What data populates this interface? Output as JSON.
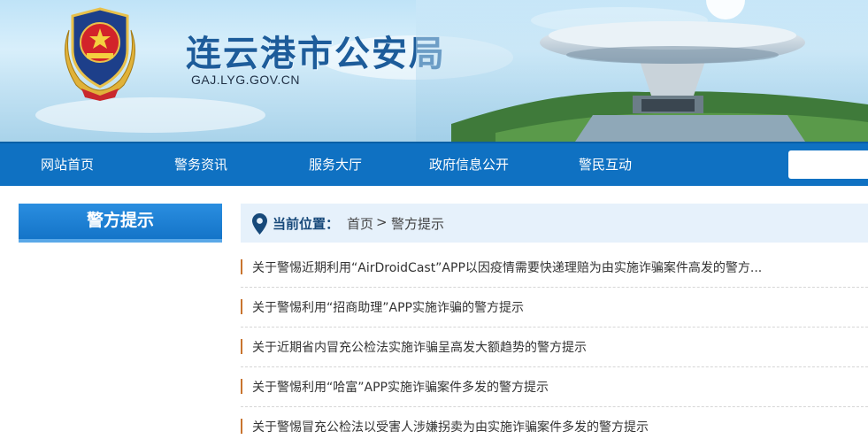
{
  "header": {
    "site_title": "连云港市公安局",
    "site_domain": "GAJ.LYG.GOV.CN",
    "emblem_icon": "police-emblem-icon"
  },
  "nav": {
    "items": [
      {
        "label": "网站首页"
      },
      {
        "label": "警务资讯"
      },
      {
        "label": "服务大厅"
      },
      {
        "label": "政府信息公开"
      },
      {
        "label": "警民互动"
      }
    ],
    "search_placeholder": ""
  },
  "sidebar": {
    "title": "警方提示"
  },
  "breadcrumb": {
    "icon": "location-pin-icon",
    "label": "当前位置：",
    "home": "首页",
    "separator": ">",
    "current": "警方提示"
  },
  "articles": [
    {
      "title": "关于警惕近期利用“AirDroidCast”APP以因疫情需要快递理赔为由实施诈骗案件高发的警方..."
    },
    {
      "title": "关于警惕利用“招商助理”APP实施诈骗的警方提示"
    },
    {
      "title": "关于近期省内冒充公检法实施诈骗呈高发大额趋势的警方提示"
    },
    {
      "title": "关于警惕利用“哈富”APP实施诈骗案件多发的警方提示"
    },
    {
      "title": "关于警惕冒充公检法以受害人涉嫌拐卖为由实施诈骗案件多发的警方提示"
    }
  ],
  "colors": {
    "nav_bg": "#0f71c2",
    "title_blue": "#1d5c9a",
    "list_marker": "#c9742f",
    "breadcrumb_bg": "#e6f1fb"
  }
}
